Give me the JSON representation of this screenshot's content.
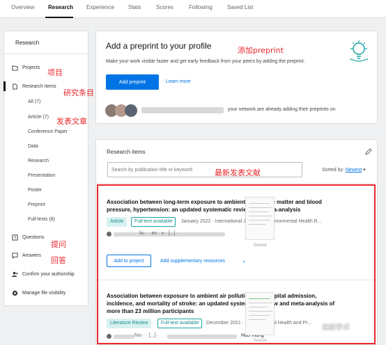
{
  "topnav": {
    "tabs": [
      {
        "label": "Overview"
      },
      {
        "label": "Research"
      },
      {
        "label": "Experience"
      },
      {
        "label": "Stats"
      },
      {
        "label": "Scores"
      },
      {
        "label": "Following"
      },
      {
        "label": "Saved List"
      }
    ],
    "active_tab": "Research"
  },
  "sidebar": {
    "title": "Research",
    "items": [
      {
        "label": "Projects",
        "icon": "folder-icon"
      },
      {
        "label": "Research items",
        "icon": "document-icon"
      },
      {
        "label": "Questions",
        "icon": "question-icon"
      },
      {
        "label": "Answers",
        "icon": "chat-icon"
      },
      {
        "label": "Confirm your authorship",
        "icon": "add-user-icon"
      },
      {
        "label": "Manage file visibility",
        "icon": "eye-icon"
      }
    ],
    "sub_items": [
      {
        "label": "All (7)"
      },
      {
        "label": "Article (7)"
      },
      {
        "label": "Conference Paper"
      },
      {
        "label": "Data"
      },
      {
        "label": "Research"
      },
      {
        "label": "Presentation"
      },
      {
        "label": "Poster"
      },
      {
        "label": "Preprint"
      },
      {
        "label": "Full-texts (6)"
      }
    ]
  },
  "preprint": {
    "title": "Add a preprint to your profile",
    "description": "Make your work visible faster and get early feedback from your peers by adding the preprint.",
    "primary_button": "Add preprint",
    "link": "Learn more"
  },
  "peers": {
    "text": "your network are already adding their preprints on"
  },
  "research_items": {
    "title": "Research items",
    "search_placeholder": "Search by publication title or keyword",
    "sort_label": "Sorted by:",
    "sort_value": "Newest",
    "entries": [
      {
        "title": "Association between long-term exposure to ambient particulate matter and blood pressure, hypertension: an updated systematic review and meta-analysis",
        "type": "Article",
        "availability": "Full-text available",
        "date": "January 2022",
        "journal": "· International Journal of Environmental Health R...",
        "authors": "liu · · an · u · [...] ·",
        "source": "Source"
      },
      {
        "title": "Association between exposure to ambient air pollution and hospital admission, incidence, and mortality of stroke: an updated systematic review and meta-analysis of more than 23 million participants",
        "type": "Literature Review",
        "availability": "Full-text available",
        "date": "December 2021",
        "journal": "· Environmental Health and Pr...",
        "authors": "Niu · · [...] ·",
        "last_author": "Hao Xiang",
        "source": "Source"
      }
    ],
    "add_to_project": "Add to project",
    "add_supplementary": "Add supplementary resources"
  },
  "annotations": {
    "add_preprint": "添加preprint",
    "projects": "项目",
    "research_items": "研究条目",
    "published_articles": "发表文章",
    "latest_publications": "最新发表文献",
    "questions": "提问",
    "answers": "回答"
  },
  "watermark": "梅斯学术",
  "colors": {
    "accent": "#0074e4",
    "annotation": "#e8262a",
    "badge": "#1aa3a3"
  }
}
